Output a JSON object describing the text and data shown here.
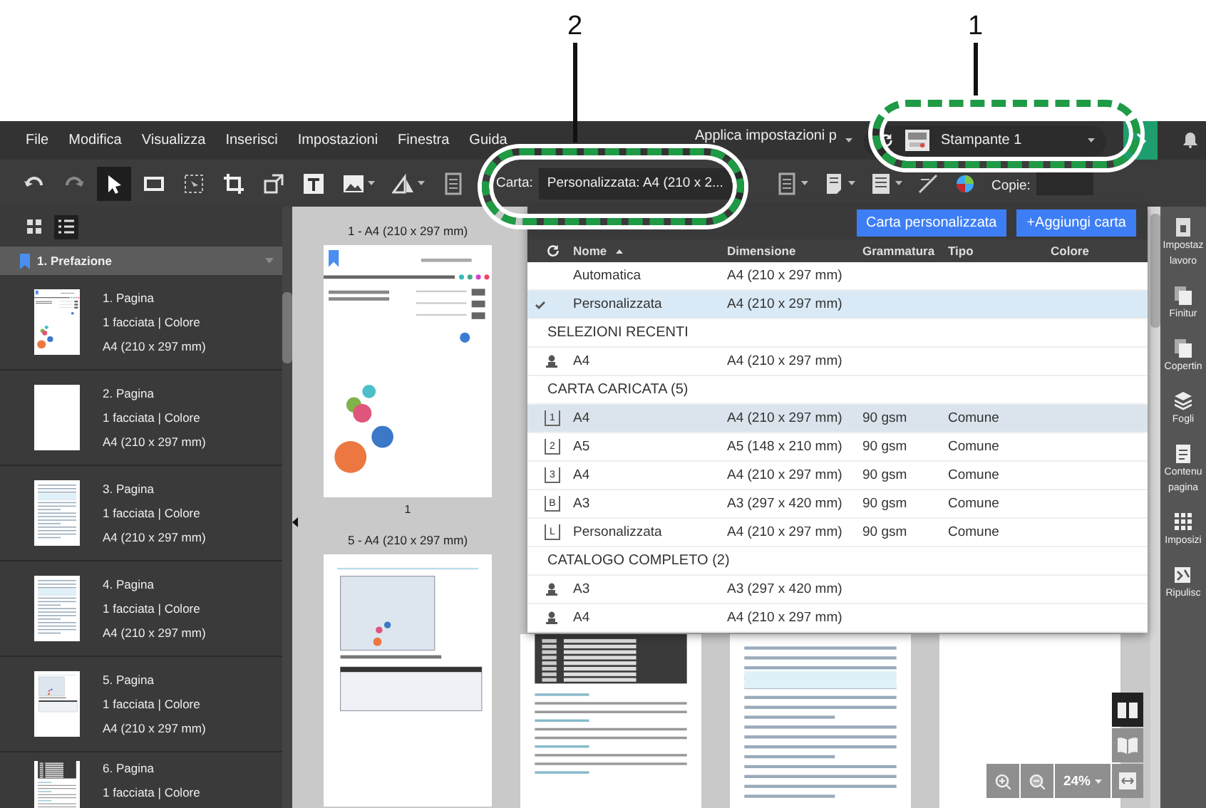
{
  "callouts": [
    {
      "number": "2",
      "kind": "paper"
    },
    {
      "number": "1",
      "kind": "printer"
    }
  ],
  "menubar": {
    "items": [
      "File",
      "Modifica",
      "Visualizza",
      "Inserisci",
      "Impostazioni",
      "Finestra",
      "Guida"
    ],
    "apply_label": "Applica impostazioni p",
    "printer": "Stampante 1"
  },
  "toolbar": {
    "tools_left": [
      {
        "kind": "undo",
        "selected": false,
        "caret": false
      },
      {
        "kind": "redo",
        "selected": false,
        "caret": false
      },
      {
        "kind": "pointer",
        "selected": true,
        "caret": false
      },
      {
        "kind": "rectangle",
        "selected": false,
        "caret": false
      },
      {
        "kind": "select-area",
        "selected": false,
        "caret": false
      },
      {
        "kind": "crop",
        "selected": false,
        "caret": false
      },
      {
        "kind": "transform",
        "selected": false,
        "caret": false
      },
      {
        "kind": "text",
        "selected": false,
        "caret": false
      },
      {
        "kind": "image",
        "selected": false,
        "caret": true
      },
      {
        "kind": "shape",
        "selected": false,
        "caret": true
      },
      {
        "kind": "page",
        "selected": false,
        "caret": false
      }
    ],
    "paper_label": "Carta:",
    "paper_value": "Personalizzata: A4 (210 x 2...",
    "tools_right": [
      {
        "kind": "layout",
        "caret": true
      },
      {
        "kind": "document",
        "caret": true
      },
      {
        "kind": "document-lines",
        "caret": true
      },
      {
        "kind": "ruler",
        "caret": false
      },
      {
        "kind": "color-wheel",
        "caret": false
      }
    ],
    "copies_label": "Copie:"
  },
  "sidebar": {
    "views": [
      {
        "kind": "grid",
        "selected": false
      },
      {
        "kind": "list",
        "selected": true
      }
    ],
    "section": "1. Prefazione",
    "items": [
      {
        "title": "1. Pagina",
        "lines": [
          "1 facciata | Colore",
          "A4 (210 x 297 mm)"
        ],
        "kind": "cover"
      },
      {
        "title": "2. Pagina",
        "lines": [
          "1 facciata | Colore",
          "A4 (210 x 297 mm)"
        ],
        "kind": "blank"
      },
      {
        "title": "3. Pagina",
        "lines": [
          "1 facciata | Colore",
          "A4 (210 x 297 mm)"
        ],
        "kind": "text"
      },
      {
        "title": "4. Pagina",
        "lines": [
          "1 facciata | Colore",
          "A4 (210 x 297 mm)"
        ],
        "kind": "text"
      },
      {
        "title": "5. Pagina",
        "lines": [
          "1 facciata | Colore",
          "A4 (210 x 297 mm)"
        ],
        "kind": "screenshot"
      },
      {
        "title": "6. Pagina",
        "lines": [
          "1 facciata | Colore"
        ],
        "kind": "screenshot-dark"
      }
    ]
  },
  "pages": [
    {
      "caption": "1 - A4 (210 x 297 mm)",
      "number": "1",
      "kind": "cover"
    },
    {
      "caption": "5 - A4 (210 x 297 mm)",
      "kind": "screenshot"
    },
    {
      "kind": "screenshot-dark"
    },
    {
      "kind": "text"
    },
    {
      "kind": "blank"
    }
  ],
  "paper_menu": {
    "buttons": [
      "Carta personalizzata",
      "+Aggiungi carta"
    ],
    "columns": [
      "Nome",
      "Dimensione",
      "Grammatura",
      "Tipo",
      "Colore"
    ],
    "rows": [
      {
        "kind": "option",
        "name": "Automatica",
        "size": "A4 (210 x 297 mm)",
        "selected": false
      },
      {
        "kind": "option",
        "name": "Personalizzata",
        "size": "A4 (210 x 297 mm)",
        "selected": true
      },
      {
        "kind": "section",
        "label": "SELEZIONI RECENTI"
      },
      {
        "kind": "user",
        "name": "A4",
        "size": "A4 (210 x 297 mm)"
      },
      {
        "kind": "section",
        "label": "CARTA CARICATA (5)"
      },
      {
        "kind": "tray",
        "tray": "1",
        "name": "A4",
        "size": "A4 (210 x 297 mm)",
        "weight": "90 gsm",
        "type": "Comune",
        "highlighted": true
      },
      {
        "kind": "tray",
        "tray": "2",
        "name": "A5",
        "size": "A5 (148 x 210 mm)",
        "weight": "90 gsm",
        "type": "Comune",
        "highlighted": false
      },
      {
        "kind": "tray",
        "tray": "3",
        "name": "A4",
        "size": "A4 (210 x 297 mm)",
        "weight": "90 gsm",
        "type": "Comune",
        "highlighted": false
      },
      {
        "kind": "tray",
        "tray": "B",
        "name": "A3",
        "size": "A3 (297 x 420 mm)",
        "weight": "90 gsm",
        "type": "Comune",
        "highlighted": false
      },
      {
        "kind": "tray",
        "tray": "L",
        "name": "Personalizzata",
        "size": "A4 (210 x 297 mm)",
        "weight": "90 gsm",
        "type": "Comune",
        "highlighted": false
      },
      {
        "kind": "section",
        "label": "CATALOGO COMPLETO (2)"
      },
      {
        "kind": "user",
        "name": "A3",
        "size": "A3 (297 x 420 mm)"
      },
      {
        "kind": "user",
        "name": "A4",
        "size": "A4 (210 x 297 mm)"
      }
    ]
  },
  "zoom": {
    "level": "24%",
    "views": [
      {
        "kind": "two-page",
        "selected": true
      },
      {
        "kind": "book",
        "selected": false
      }
    ]
  },
  "right_panel": [
    {
      "kind": "job",
      "lines": [
        "Impostaz",
        "lavoro"
      ]
    },
    {
      "kind": "finishing",
      "lines": [
        "Finitur"
      ]
    },
    {
      "kind": "cover",
      "lines": [
        "Copertin"
      ]
    },
    {
      "kind": "sheets",
      "lines": [
        "Fogli"
      ]
    },
    {
      "kind": "content",
      "lines": [
        "Contenu",
        "pagina"
      ]
    },
    {
      "kind": "imposition",
      "lines": [
        "Imposizi"
      ]
    },
    {
      "kind": "cleanup",
      "lines": [
        "Ripulisc"
      ]
    }
  ]
}
